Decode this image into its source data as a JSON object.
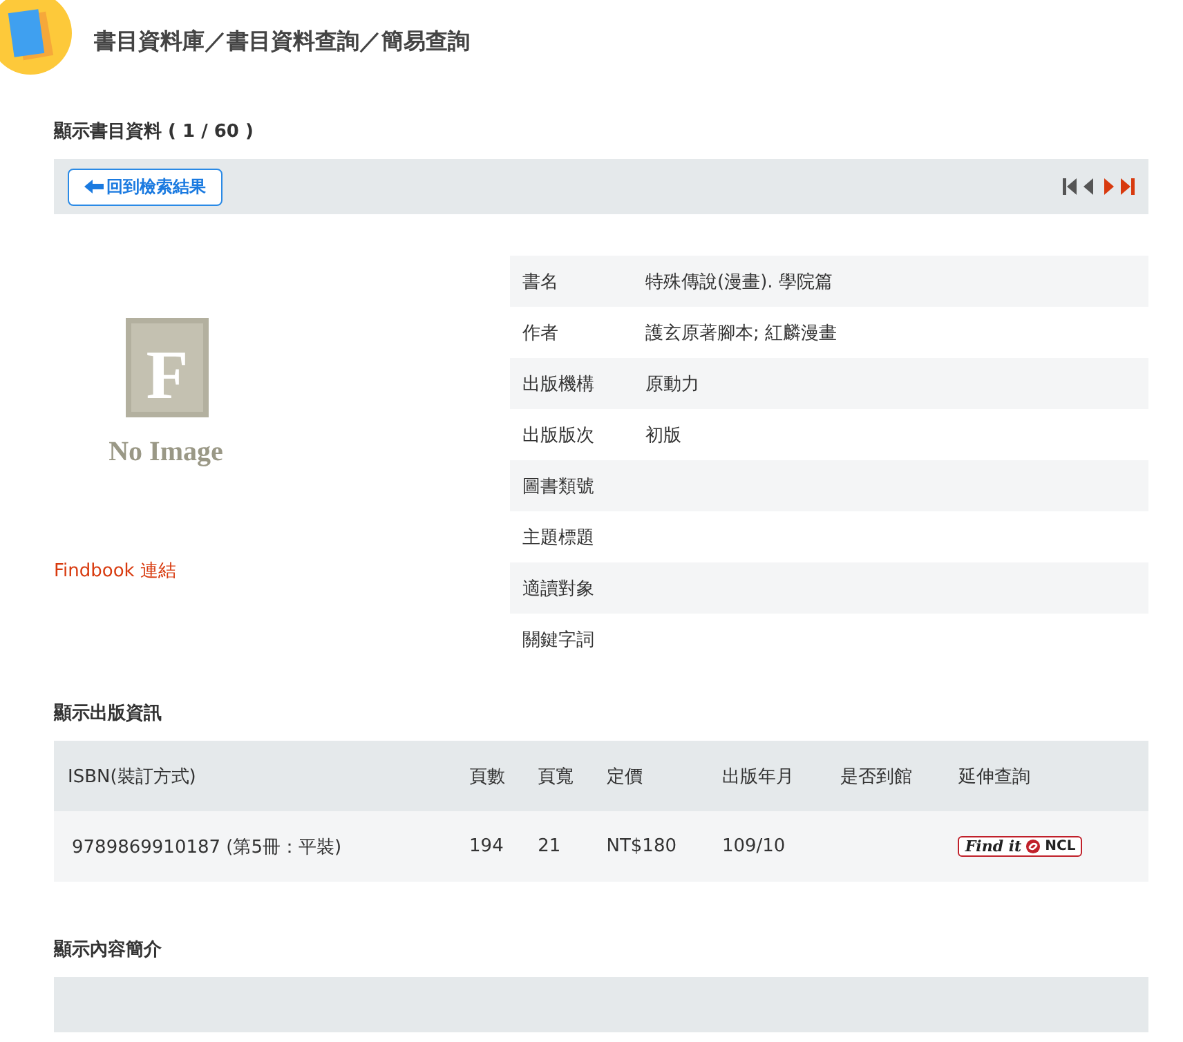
{
  "header": {
    "breadcrumb": "書目資料庫／書目資料查詢／簡易查詢"
  },
  "record": {
    "title": "顯示書目資料 ( 1 / 60 )",
    "back_button": "回到檢索結果",
    "pager": [
      {
        "kind": "first",
        "disabled": true
      },
      {
        "kind": "prev",
        "disabled": true
      },
      {
        "kind": "next",
        "disabled": false
      },
      {
        "kind": "last",
        "disabled": false
      }
    ]
  },
  "cover": {
    "letter": "F",
    "caption": "No Image"
  },
  "findbook_link": "Findbook 連結",
  "details": [
    {
      "label": "書名",
      "value": "特殊傳說(漫畫). 學院篇"
    },
    {
      "label": "作者",
      "value": "護玄原著腳本; 紅麟漫畫"
    },
    {
      "label": "出版機構",
      "value": "原動力"
    },
    {
      "label": "出版版次",
      "value": "初版"
    },
    {
      "label": "圖書類號"
    },
    {
      "label": "主題標題"
    },
    {
      "label": "適讀對象"
    },
    {
      "label": "關鍵字詞"
    }
  ],
  "publication": {
    "title": "顯示出版資訊",
    "columns": [
      "ISBN(裝訂方式)",
      "頁數",
      "頁寬",
      "定價",
      "出版年月",
      "是否到館",
      "延伸查詢"
    ],
    "rows": [
      {
        "cells": [
          "9789869910187 (第5冊：平裝)",
          "194",
          "21",
          "NT$180",
          "109/10",
          ""
        ],
        "link": {
          "left": "Find it",
          "right": "NCL"
        }
      }
    ]
  },
  "summary": {
    "title": "顯示內容簡介"
  }
}
